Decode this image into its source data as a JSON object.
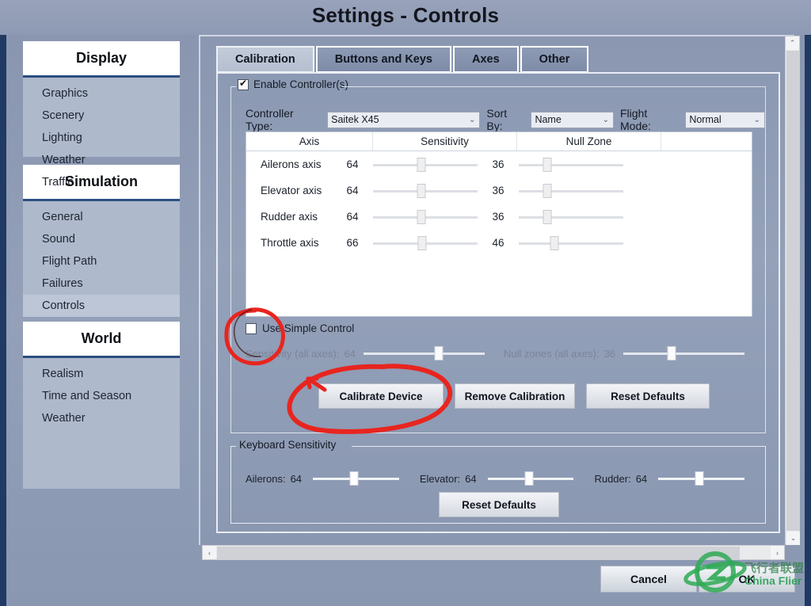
{
  "window": {
    "title": "Settings - Controls"
  },
  "sidebar": {
    "sections": [
      {
        "header": "Display",
        "items": [
          {
            "label": "Graphics",
            "selected": false
          },
          {
            "label": "Scenery",
            "selected": false
          },
          {
            "label": "Lighting",
            "selected": false
          },
          {
            "label": "Weather",
            "selected": false
          },
          {
            "label": "Traffic",
            "selected": false
          }
        ]
      },
      {
        "header": "Simulation",
        "items": [
          {
            "label": "General",
            "selected": false
          },
          {
            "label": "Sound",
            "selected": false
          },
          {
            "label": "Flight Path",
            "selected": false
          },
          {
            "label": "Failures",
            "selected": false
          },
          {
            "label": "Controls",
            "selected": true
          }
        ]
      },
      {
        "header": "World",
        "items": [
          {
            "label": "Realism",
            "selected": false
          },
          {
            "label": "Time and Season",
            "selected": false
          },
          {
            "label": "Weather",
            "selected": false
          }
        ]
      }
    ]
  },
  "tabs": [
    {
      "label": "Calibration",
      "active": true
    },
    {
      "label": "Buttons and Keys",
      "active": false
    },
    {
      "label": "Axes",
      "active": false
    },
    {
      "label": "Other",
      "active": false
    }
  ],
  "enable_group": {
    "legend": "Enable Controller(s)",
    "checked": true
  },
  "controls_row": {
    "controller_type_label": "Controller Type:",
    "controller_type_value": "Saitek X45",
    "sort_by_label": "Sort By:",
    "sort_by_value": "Name",
    "flight_mode_label": "Flight Mode:",
    "flight_mode_value": "Normal"
  },
  "axis_table": {
    "headers": [
      "Axis",
      "Sensitivity",
      "Null Zone",
      ""
    ],
    "rows": [
      {
        "name": "Ailerons axis",
        "sensitivity": "64",
        "sens_pct": 46,
        "null_zone": "36",
        "null_pct": 27
      },
      {
        "name": "Elevator axis",
        "sensitivity": "64",
        "sens_pct": 46,
        "null_zone": "36",
        "null_pct": 27
      },
      {
        "name": "Rudder axis",
        "sensitivity": "64",
        "sens_pct": 46,
        "null_zone": "36",
        "null_pct": 27
      },
      {
        "name": "Throttle axis",
        "sensitivity": "66",
        "sens_pct": 47,
        "null_zone": "46",
        "null_pct": 34
      }
    ]
  },
  "simple_control": {
    "label": "Use Simple Control",
    "checked": false
  },
  "all_axes": {
    "sensitivity_label": "Sensitivity (all axes):",
    "sensitivity_value": "64",
    "sensitivity_pct": 62,
    "null_label": "Null zones (all axes):",
    "null_value": "36",
    "null_pct": 40,
    "disabled": true
  },
  "buttons": {
    "calibrate": "Calibrate Device",
    "remove": "Remove Calibration",
    "reset": "Reset Defaults"
  },
  "keyboard": {
    "legend": "Keyboard Sensitivity",
    "ailerons_label": "Ailerons:",
    "ailerons_value": "64",
    "ailerons_pct": 48,
    "elevator_label": "Elevator:",
    "elevator_value": "64",
    "elevator_pct": 48,
    "rudder_label": "Rudder:",
    "rudder_value": "64",
    "rudder_pct": 48,
    "reset": "Reset Defaults"
  },
  "bottom": {
    "cancel": "Cancel",
    "ok": "OK"
  },
  "scrollbars": {
    "up_arrow": "⌃",
    "down_arrow": "⌄",
    "left_arrow": "‹",
    "right_arrow": "›"
  },
  "watermark": {
    "text_cn": "飞行者联盟",
    "text_en": "China Flier",
    "color": "#1f9d4d"
  },
  "annotations": {
    "color": "#e8251f",
    "note": "hand-drawn red circles around Use Simple Control checkbox and Calibrate Device button"
  }
}
